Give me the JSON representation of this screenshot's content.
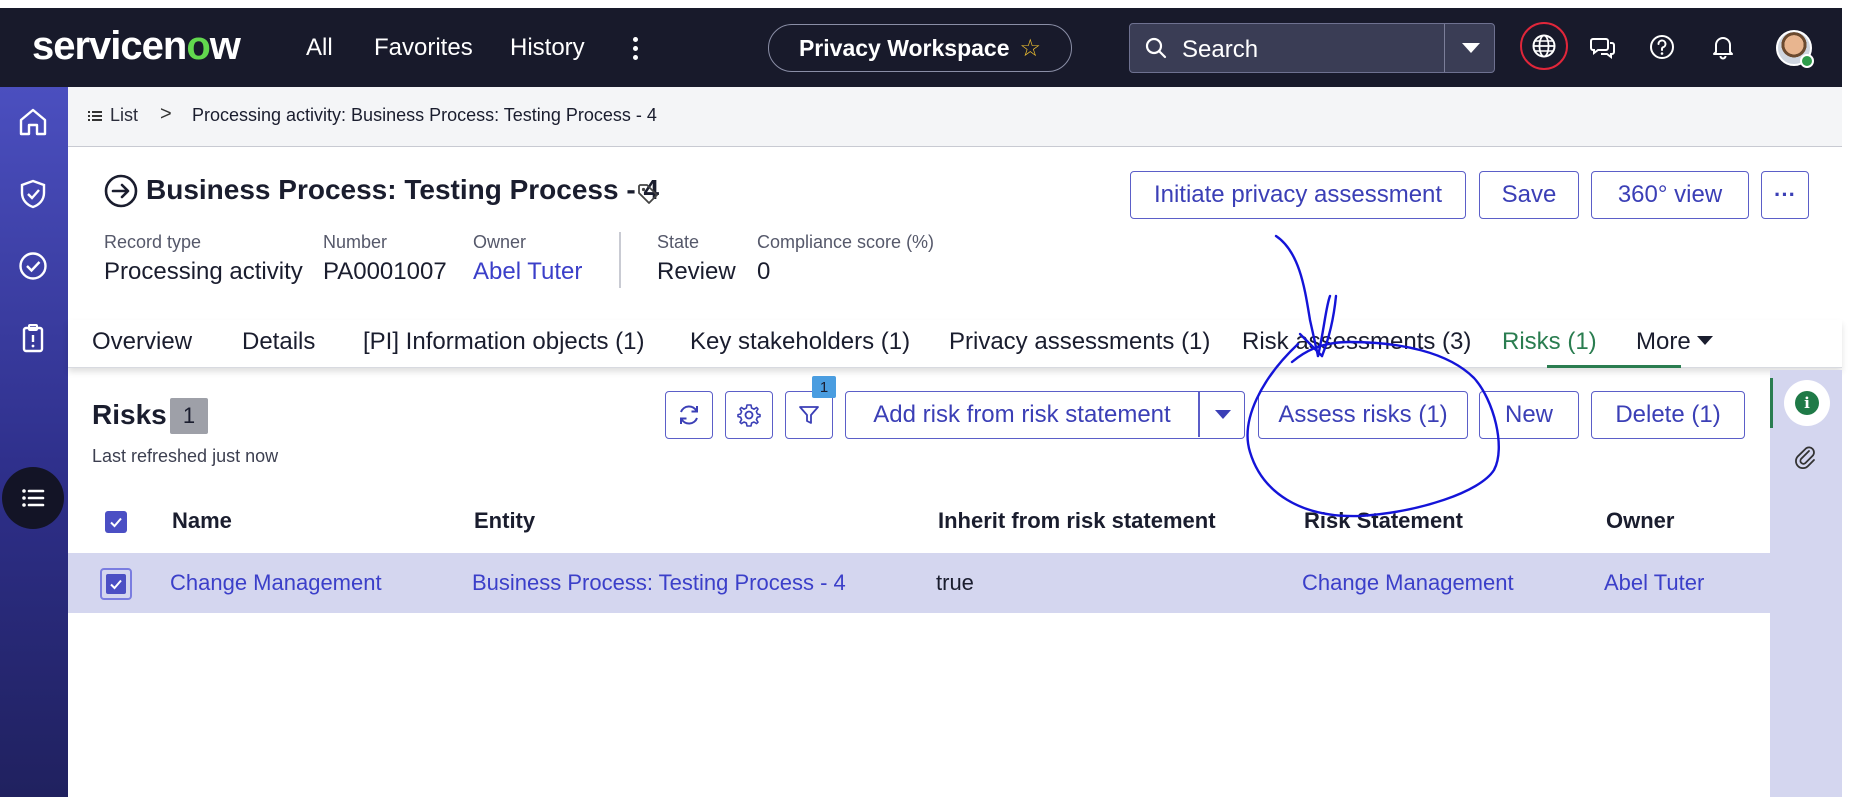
{
  "topbar": {
    "logo_pre": "servicen",
    "logo_o": "o",
    "logo_post": "w",
    "nav": [
      "All",
      "Favorites",
      "History"
    ],
    "workspace": "Privacy Workspace",
    "search_placeholder": "Search",
    "icons": [
      "globe-icon",
      "chat-icon",
      "help-icon",
      "bell-icon"
    ]
  },
  "rail": {
    "icons": [
      "home-icon",
      "shield-icon",
      "check-circle-icon",
      "clipboard-icon",
      "list-icon"
    ]
  },
  "breadcrumb": {
    "list": "List",
    "separator": ">",
    "current": "Processing activity: Business Process: Testing Process - 4"
  },
  "record": {
    "title": "Business Process: Testing Process - 4",
    "buttons": {
      "initiate": "Initiate privacy assessment",
      "save": "Save",
      "view360": "360° view",
      "more": "···"
    },
    "fields": {
      "record_type": {
        "label": "Record type",
        "value": "Processing activity"
      },
      "number": {
        "label": "Number",
        "value": "PA0001007"
      },
      "owner": {
        "label": "Owner",
        "value": "Abel Tuter"
      },
      "state": {
        "label": "State",
        "value": "Review"
      },
      "compliance": {
        "label": "Compliance score (%)",
        "value": "0"
      }
    }
  },
  "tabs": [
    "Overview",
    "Details",
    "[PI] Information objects (1)",
    "Key stakeholders (1)",
    "Privacy assessments (1)",
    "Risk assessments (3)",
    "Risks (1)",
    "More"
  ],
  "active_tab": "Risks (1)",
  "related_list": {
    "title": "Risks",
    "count": "1",
    "refreshed": "Last refreshed just now",
    "filter_badge": "1",
    "buttons": {
      "add_from_statement": "Add risk from risk statement",
      "assess": "Assess risks (1)",
      "new": "New",
      "delete": "Delete (1)"
    },
    "columns": [
      "Name",
      "Entity",
      "Inherit from risk statement",
      "Risk Statement",
      "Owner"
    ],
    "rows": [
      {
        "selected": true,
        "name": "Change Management",
        "entity": "Business Process: Testing Process - 4",
        "inherit": "true",
        "risk_statement": "Change Management",
        "owner": "Abel Tuter"
      }
    ]
  },
  "colors": {
    "topbar": "#181a2b",
    "accent": "#3b3fb6",
    "active_tab": "#2a7d50",
    "selected_row": "#d4d6ef",
    "annotation": "#1414d8"
  }
}
